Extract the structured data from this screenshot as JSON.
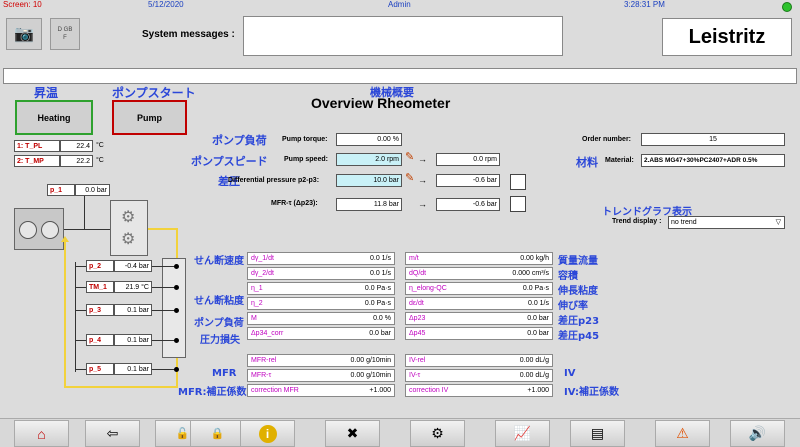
{
  "topbar": {
    "screen_label": "Screen:",
    "screen_num": "10",
    "date": "5/12/2020",
    "user": "Admin",
    "time": "3:28:31 PM"
  },
  "header": {
    "system_messages_label": "System messages :",
    "system_messages_value": "",
    "brand": "Leistritz",
    "lang_labels": [
      "D",
      "GB",
      "F"
    ]
  },
  "title": {
    "jp": "機械概要",
    "main": "Overview Rheometer"
  },
  "heating": {
    "jp": "昇温",
    "label": "Heating"
  },
  "pump": {
    "jp": "ポンプスタート",
    "label": "Pump"
  },
  "temps": [
    {
      "name": "1: T_PL",
      "value": "22.4",
      "unit": "°C"
    },
    {
      "name": "2: T_MP",
      "value": "22.2",
      "unit": "°C"
    }
  ],
  "p1": {
    "name": "p_1",
    "value": "0.0 bar"
  },
  "pump_params": {
    "torque": {
      "jp": "ポンプ負荷",
      "label": "Pump torque:",
      "value": "0.00 %"
    },
    "speed": {
      "jp": "ポンプスピード",
      "label": "Pump speed:",
      "value": "2.0 rpm",
      "result": "0.0 rpm"
    },
    "diff": {
      "jp": "差圧",
      "label": "Differential pressure p2-p3:",
      "value": "10.0 bar",
      "result": "-0.6 bar"
    },
    "mfr": {
      "label": "MFR-τ (Δp23):",
      "value": "11.8 bar",
      "result": "-0.6 bar"
    }
  },
  "order": {
    "label": "Order number:",
    "value": "15"
  },
  "material": {
    "jp": "材料",
    "label": "Material:",
    "value": "2.ABS MG47+30%PC2407+ADR 0.5%"
  },
  "trend": {
    "jp": "トレンドグラフ表示",
    "label": "Trend display :",
    "value": "no trend"
  },
  "pressures": [
    {
      "name": "p_2",
      "value": "-0.4 bar"
    },
    {
      "name": "TM_1",
      "value": "21.9 °C"
    },
    {
      "name": "p_3",
      "value": "0.1 bar"
    },
    {
      "name": "p_4",
      "value": "0.1 bar"
    },
    {
      "name": "p_5",
      "value": "0.1 bar"
    }
  ],
  "left_jp": [
    "せん断速度",
    "せん断粘度",
    "ポンプ負荷",
    "圧力損失"
  ],
  "left_rows": [
    {
      "name": "dγ_1/dt",
      "value": "0.0 1/s"
    },
    {
      "name": "dγ_2/dt",
      "value": "0.0 1/s"
    },
    {
      "name": "η_1",
      "value": "0.0 Pa·s"
    },
    {
      "name": "η_2",
      "value": "0.0 Pa·s"
    },
    {
      "name": "M",
      "value": "0.0 %"
    },
    {
      "name": "Δp34_corr",
      "value": "0.0 bar"
    }
  ],
  "right_rows": [
    {
      "name": "m/t",
      "value": "0.00 kg/h"
    },
    {
      "name": "dQ/dt",
      "value": "0.000 cm³/s"
    },
    {
      "name": "η_elong-QC",
      "value": "0.0 Pa·s"
    },
    {
      "name": "dε/dt",
      "value": "0.0 1/s"
    },
    {
      "name": "Δp23",
      "value": "0.0 bar"
    },
    {
      "name": "Δp45",
      "value": "0.0 bar"
    }
  ],
  "right_jp": [
    "質量流量",
    "容積",
    "伸長粘度",
    "伸び率",
    "差圧p23",
    "差圧p45"
  ],
  "mfr_jp": [
    "MFR",
    "MFR:補正係数"
  ],
  "mfr_rows": [
    {
      "name": "MFR-rel",
      "value": "0.00 g/10min"
    },
    {
      "name": "MFR-τ",
      "value": "0.00 g/10min"
    },
    {
      "name": "correction MFR",
      "value": "+1.000"
    }
  ],
  "iv_rows": [
    {
      "name": "IV-rel",
      "value": "0.00 dL/g"
    },
    {
      "name": "IV-τ",
      "value": "0.00 dL/g"
    },
    {
      "name": "correction IV",
      "value": "+1.000"
    }
  ],
  "iv_jp": [
    "IV",
    "IV:補正係数"
  ],
  "bottom": [
    "home-icon",
    "back-icon",
    "unlock-icon",
    "lock-icon",
    "info-icon",
    "tools-icon",
    "settings-icon",
    "trend-icon",
    "export-icon",
    "warning-icon",
    "speaker-icon"
  ],
  "colors": {
    "accent": "#2b47d8",
    "pink": "#c000c0",
    "red": "#c00000",
    "cyan": "#c9f1f7",
    "heating_border": "#2ea12e",
    "pump_border": "#c00000",
    "status": "#2ec32e"
  }
}
